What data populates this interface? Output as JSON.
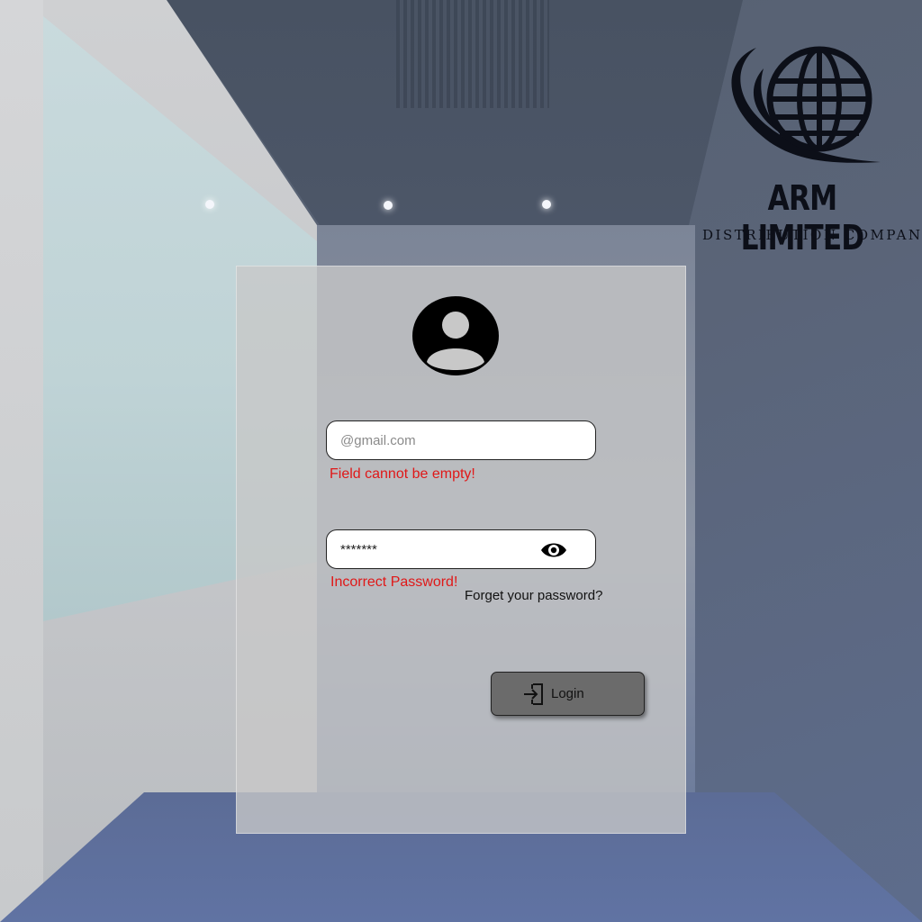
{
  "brand": {
    "name": "ARM LIMITED",
    "tagline": "DISTRIBUTION COMPANY"
  },
  "login": {
    "email_placeholder": "@gmail.com",
    "email_value": "",
    "email_error": "Field cannot be empty!",
    "password_value": "*******",
    "password_error": "Incorrect Password!",
    "forgot_label": "Forget your password?",
    "submit_label": "Login"
  },
  "icons": {
    "avatar": "user-avatar-icon",
    "visibility": "eye-icon",
    "submit": "login-icon",
    "logo": "globe-logo-icon"
  },
  "colors": {
    "error": "#e01818",
    "button": "#6b6b6b",
    "card": "#c8c8c8"
  }
}
